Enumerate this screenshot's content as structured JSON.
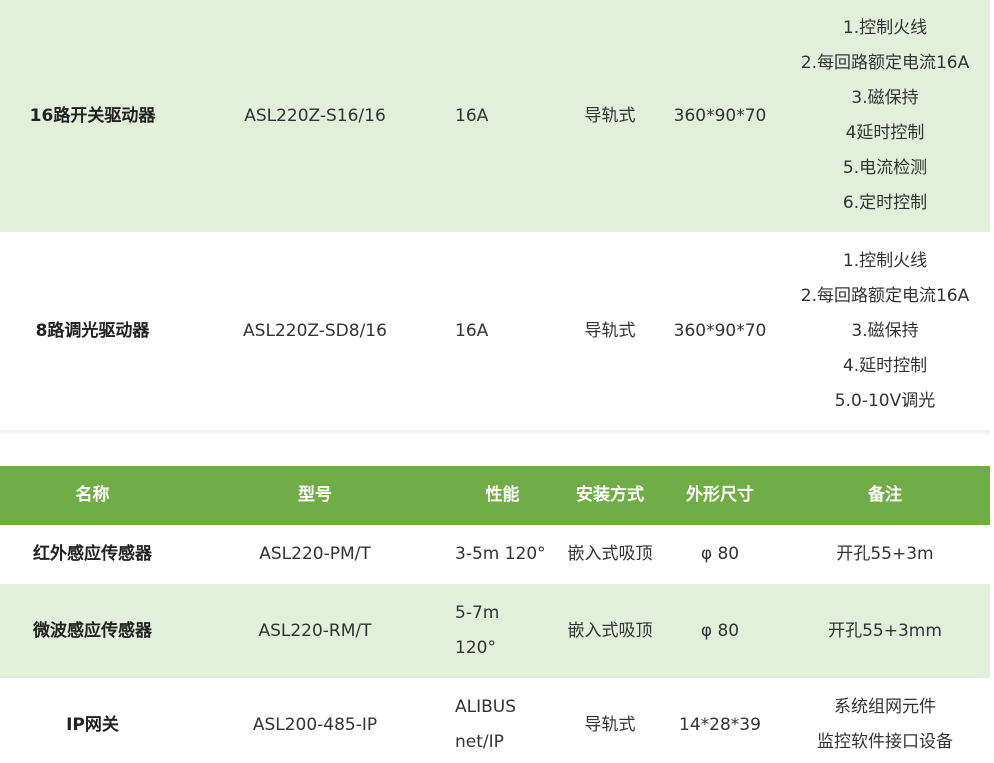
{
  "table1": {
    "rows": [
      {
        "name": "16路开关驱动器",
        "model": "ASL220Z-S16/16",
        "performance": "16A",
        "install": "导轨式",
        "size": "360*90*70",
        "notes": [
          "1.控制火线",
          "2.每回路额定电流16A",
          "3.磁保持",
          "4延时控制",
          "5.电流检测",
          "6.定时控制"
        ]
      },
      {
        "name": "8路调光驱动器",
        "model": "ASL220Z-SD8/16",
        "performance": "16A",
        "install": "导轨式",
        "size": "360*90*70",
        "notes": [
          "1.控制火线",
          "2.每回路额定电流16A",
          "3.磁保持",
          "4.延时控制",
          "5.0-10V调光"
        ]
      }
    ]
  },
  "table2": {
    "headers": [
      "名称",
      "型号",
      "性能",
      "安装方式",
      "外形尺寸",
      "备注"
    ],
    "rows": [
      {
        "name": "红外感应传感器",
        "model": "ASL220-PM/T",
        "performance": [
          "3-5m 120°"
        ],
        "install": "嵌入式吸顶",
        "size": "φ 80",
        "notes": [
          "开孔55+3m"
        ]
      },
      {
        "name": "微波感应传感器",
        "model": "ASL220-RM/T",
        "performance": [
          "5-7m",
          "120°"
        ],
        "install": "嵌入式吸顶",
        "size": "φ 80",
        "notes": [
          "开孔55+3mm"
        ]
      },
      {
        "name": "IP网关",
        "model": "ASL200-485-IP",
        "performance": [
          "ALIBUS",
          "net/IP"
        ],
        "install": "导轨式",
        "size": "14*28*39",
        "notes": [
          "系统组网元件",
          "监控软件接口设备"
        ]
      }
    ]
  },
  "colors": {
    "header_green": "#70ad47",
    "row_green": "#e2efda",
    "row_white": "#ffffff"
  }
}
